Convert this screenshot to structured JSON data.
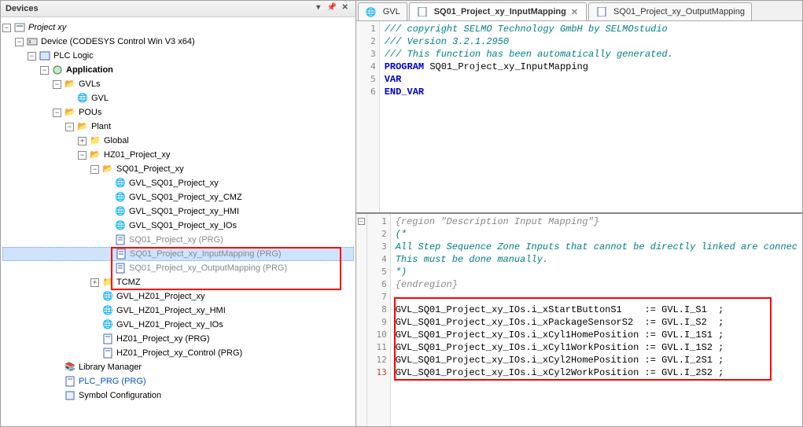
{
  "panel": {
    "title": "Devices"
  },
  "tree": {
    "n0": {
      "label": "Project xy",
      "expander": "−"
    },
    "n1": {
      "label": "Device (CODESYS Control Win V3 x64)",
      "expander": "−"
    },
    "n2": {
      "label": "PLC Logic",
      "expander": "−"
    },
    "n3": {
      "label": "Application",
      "expander": "−"
    },
    "n4": {
      "label": "GVLs",
      "expander": "−"
    },
    "n5": {
      "label": "GVL"
    },
    "n6": {
      "label": "POUs",
      "expander": "−"
    },
    "n7": {
      "label": "Plant",
      "expander": "−"
    },
    "n8": {
      "label": "Global",
      "expander": "+"
    },
    "n9": {
      "label": "HZ01_Project_xy",
      "expander": "−"
    },
    "n10": {
      "label": "SQ01_Project_xy",
      "expander": "−"
    },
    "n11": {
      "label": "GVL_SQ01_Project_xy"
    },
    "n12": {
      "label": "GVL_SQ01_Project_xy_CMZ"
    },
    "n13": {
      "label": "GVL_SQ01_Project_xy_HMI"
    },
    "n14": {
      "label": "GVL_SQ01_Project_xy_IOs"
    },
    "n15": {
      "label": "SQ01_Project_xy (PRG)"
    },
    "n16": {
      "label": "SQ01_Project_xy_InputMapping (PRG)"
    },
    "n17": {
      "label": "SQ01_Project_xy_OutputMapping (PRG)"
    },
    "n18": {
      "label": "TCMZ",
      "expander": "+"
    },
    "n19": {
      "label": "GVL_HZ01_Project_xy"
    },
    "n20": {
      "label": "GVL_HZ01_Project_xy_HMI"
    },
    "n21": {
      "label": "GVL_HZ01_Project_xy_IOs"
    },
    "n22": {
      "label": "HZ01_Project_xy (PRG)"
    },
    "n23": {
      "label": "HZ01_Project_xy_Control (PRG)"
    },
    "n24": {
      "label": "Library Manager"
    },
    "n25": {
      "label": "PLC_PRG (PRG)"
    },
    "n26": {
      "label": "Symbol Configuration"
    }
  },
  "tabs": {
    "t0": {
      "label": "GVL"
    },
    "t1": {
      "label": "SQ01_Project_xy_InputMapping"
    },
    "t2": {
      "label": "SQ01_Project_xy_OutputMapping"
    },
    "close": "✕"
  },
  "code_top": {
    "ln": {
      "l1": "1",
      "l2": "2",
      "l3": "3",
      "l4": "4",
      "l5": "5",
      "l6": "6"
    },
    "c1": "/// copyright SELMO Technology GmbH by SELMOstudio",
    "c2": "/// Version 3.2.1.2950",
    "c3": "/// This function has been automatically generated.",
    "c4a": "PROGRAM",
    "c4b": " SQ01_Project_xy_InputMapping",
    "c5": "VAR",
    "c6": "END_VAR"
  },
  "code_bot": {
    "ln": {
      "l1": "1",
      "l2": "2",
      "l3": "3",
      "l4": "4",
      "l5": "5",
      "l6": "6",
      "l7": "7",
      "l8": "8",
      "l9": "9",
      "l10": "10",
      "l11": "11",
      "l12": "12",
      "l13": "13"
    },
    "c1": "{region \"Description Input Mapping\"}",
    "c2": "(*",
    "c3": "All Step Sequence Zone Inputs that cannot be directly linked are connec",
    "c4": "This must be done manually.",
    "c5": "*)",
    "c6": "{endregion}",
    "c7": "",
    "c8": "GVL_SQ01_Project_xy_IOs.i_xStartButtonS1    := GVL.I_S1  ;",
    "c9": "GVL_SQ01_Project_xy_IOs.i_xPackageSensorS2  := GVL.I_S2  ;",
    "c10": "GVL_SQ01_Project_xy_IOs.i_xCyl1HomePosition := GVL.I_1S1 ;",
    "c11": "GVL_SQ01_Project_xy_IOs.i_xCyl1WorkPosition := GVL.I_1S2 ;",
    "c12": "GVL_SQ01_Project_xy_IOs.i_xCyl2HomePosition := GVL.I_2S1 ;",
    "c13": "GVL_SQ01_Project_xy_IOs.i_xCyl2WorkPosition := GVL.I_2S2 ;"
  }
}
